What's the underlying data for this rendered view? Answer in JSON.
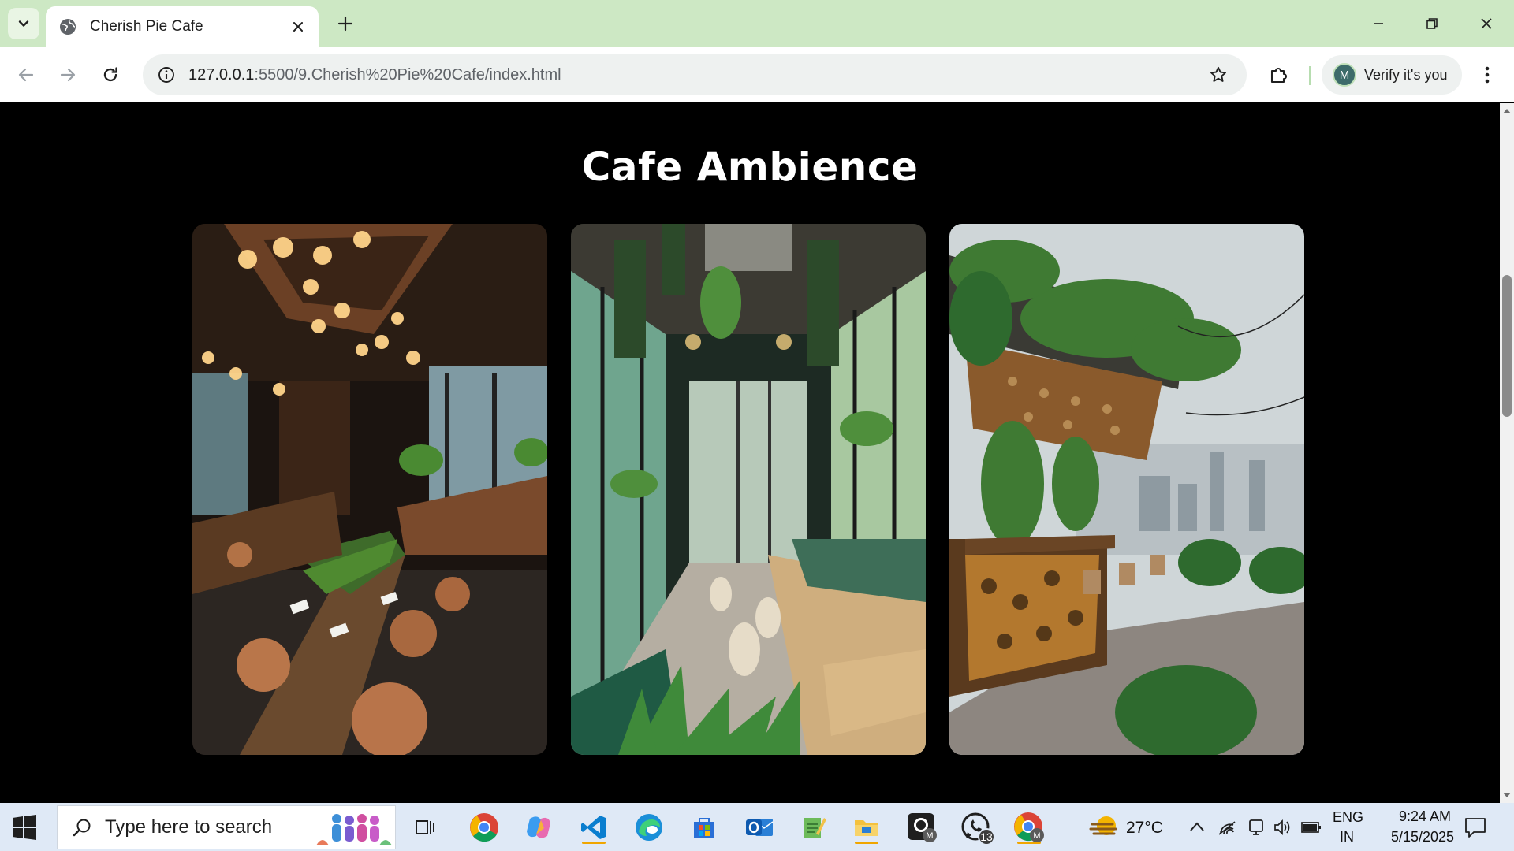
{
  "browser": {
    "tab": {
      "title": "Cherish Pie Cafe"
    },
    "address": {
      "host": "127.0.0.1",
      "path": ":5500/9.Cherish%20Pie%20Cafe/index.html"
    },
    "profile": {
      "initial": "M",
      "label": "Verify it's you"
    }
  },
  "page": {
    "section_title": "Cafe Ambience",
    "gallery": [
      {
        "name": "indoor-wooden-cafe-photo"
      },
      {
        "name": "greenhouse-cafe-photo"
      },
      {
        "name": "rooftop-bar-photo"
      }
    ]
  },
  "taskbar": {
    "search_placeholder": "Type here to search",
    "whatsapp_badge": "13",
    "weather": "27°C",
    "lang_primary": "ENG",
    "lang_secondary": "IN",
    "time": "9:24 AM",
    "date": "5/15/2025"
  },
  "colors": {
    "tab_strip": "#cde8c4",
    "page_bg": "#000000",
    "taskbar": "#dfe9f6"
  }
}
